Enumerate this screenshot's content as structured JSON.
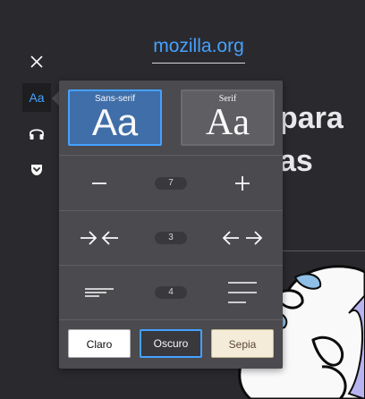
{
  "page": {
    "site_link": "mozilla.org",
    "heading_partial": "para\nas"
  },
  "toolbar": {
    "close_label": "×",
    "type_controls_label": "Aa"
  },
  "popup": {
    "fonts": [
      {
        "name": "Sans-serif",
        "sample": "Aa",
        "selected": true
      },
      {
        "name": "Serif",
        "sample": "Aa",
        "selected": false
      }
    ],
    "font_size": "7",
    "content_width": "3",
    "line_height": "4",
    "themes": [
      {
        "label": "Claro",
        "selected": false
      },
      {
        "label": "Oscuro",
        "selected": true
      },
      {
        "label": "Sepia",
        "selected": false
      }
    ]
  },
  "colors": {
    "accent": "#45a1ff",
    "background": "#2a2a2e",
    "panel": "#4a4a4f",
    "selected_font_bg": "#3f6ea8",
    "sepia": "#f4ecd8"
  }
}
